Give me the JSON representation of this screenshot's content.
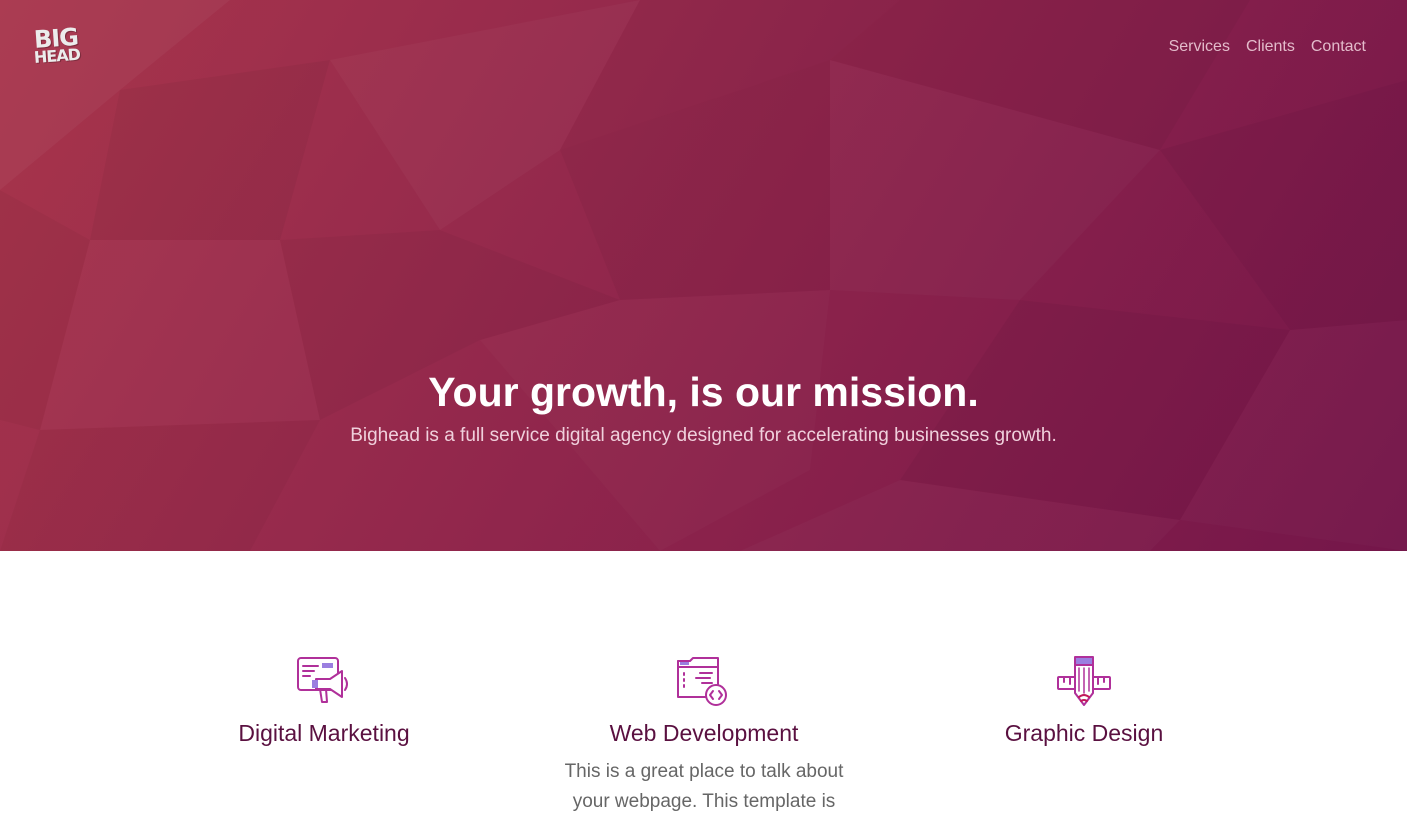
{
  "header": {
    "logo_line1": "BIG",
    "logo_line2": "HEAD",
    "nav": [
      {
        "label": "Services"
      },
      {
        "label": "Clients"
      },
      {
        "label": "Contact"
      }
    ]
  },
  "hero": {
    "title": "Your growth, is our mission.",
    "subtitle": "Bighead is a full service digital agency designed for accelerating businesses growth."
  },
  "services": [
    {
      "title": "Digital Marketing",
      "icon": "megaphone-icon",
      "text": ""
    },
    {
      "title": "Web Development",
      "icon": "browser-code-icon",
      "text": "This is a great place to talk about your webpage. This template is"
    },
    {
      "title": "Graphic Design",
      "icon": "pencil-ruler-icon",
      "text": ""
    }
  ],
  "colors": {
    "hero_start": "#a8354b",
    "hero_end": "#74164a",
    "heading": "#5a1040",
    "icon_primary": "#b0309a",
    "icon_accent": "#9b7fe0",
    "icon_red": "#c2185b"
  }
}
